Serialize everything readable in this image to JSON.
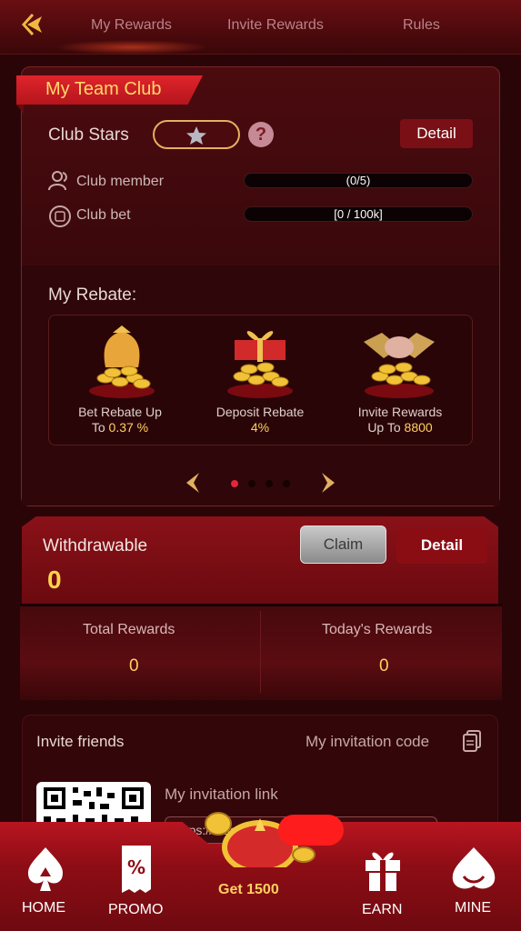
{
  "topnav": {
    "tabs": [
      "My Rewards",
      "Invite Rewards",
      "Rules"
    ]
  },
  "club": {
    "ribbon": "My Team Club",
    "stars_label": "Club Stars",
    "detail_label": "Detail",
    "member_label": "Club member",
    "member_value": "(0/5)",
    "bet_label": "Club bet",
    "bet_value": "[0 / 100k]"
  },
  "rebate": {
    "title": "My Rebate:",
    "items": [
      {
        "line1": "Bet Rebate Up",
        "line2_prefix": "To ",
        "value": "0.37 %"
      },
      {
        "line1": "Deposit Rebate",
        "line2_prefix": "",
        "value": "4%"
      },
      {
        "line1": "Invite Rewards",
        "line2_prefix": "Up To ",
        "value": "8800"
      }
    ]
  },
  "withdraw": {
    "label": "Withdrawable",
    "value": "0",
    "claim_label": "Claim",
    "detail_label": "Detail"
  },
  "rewards": {
    "total_label": "Total Rewards",
    "total_value": "0",
    "today_label": "Today's Rewards",
    "today_value": "0"
  },
  "invite": {
    "title": "Invite friends",
    "code_label": "My invitation code",
    "link_label": "My invitation link",
    "link_value": "https://...social...6"
  },
  "tabbar": {
    "home": "HOME",
    "promo": "PROMO",
    "get": "Get 1500",
    "earn": "EARN",
    "mine": "MINE"
  },
  "colors": {
    "accent": "#ffd060",
    "primary_red": "#8e0d15"
  }
}
